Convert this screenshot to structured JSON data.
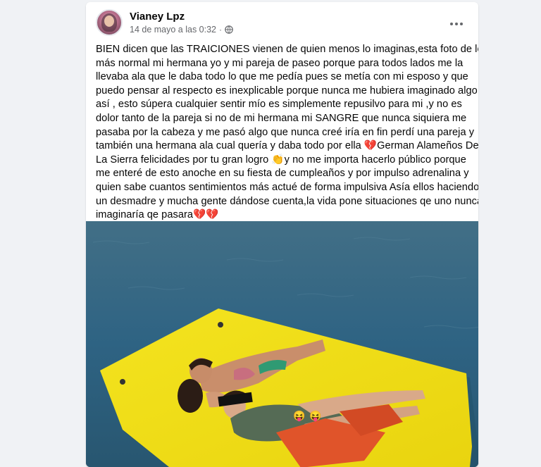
{
  "post": {
    "author": "Vianey Lpz",
    "timestamp": "14 de mayo a las 0:32",
    "separator": "·",
    "privacy_icon": "globe-icon",
    "more_icon": "more-options-icon",
    "text_lines": [
      "BIEN dicen que las TRAICIONES  vienen de quien menos lo imaginas,esta foto de lo",
      "más normal mi hermana yo y mi pareja de paseo porque para todos lados me la",
      "llevaba ala que le daba todo lo que me pedía pues se metía con mi esposo y que",
      "puedo pensar al respecto es inexplicable porque nunca me hubiera imaginado algo",
      "así , esto súpera cualquier sentir mío es simplemente repusilvo para mi ,y no es",
      "dolor tanto de la pareja si no de mi hermana mi SANGRE  que nunca siquiera me",
      "pasaba por la cabeza y me pasó algo que nunca creé iría en fin perdí una pareja y",
      "también una hermana ala cual quería y daba todo por ella 💔German Alameños De",
      "La Sierra felicidades por tu gran logro 👏y no me importa hacerlo público porque",
      "me enteré de esto anoche en su fiesta de cumpleaños y por impulso adrenalina y",
      "quien sabe cuantos sentimientos más actué de forma impulsiva Asía ellos haciendo",
      "un desmadre y mucha gente dándose cuenta,la vida pone situaciones qe uno nunca",
      "imaginaría qe pasara💔💔"
    ],
    "photo": {
      "description_icon": "lake-float-photo",
      "emoji_faces": [
        "😝",
        "😝"
      ]
    }
  },
  "colors": {
    "background": "#f0f2f5",
    "card": "#ffffff",
    "text": "#050505",
    "secondary_text": "#65676b",
    "water": "#2f6583",
    "float": "#f2e11a"
  }
}
